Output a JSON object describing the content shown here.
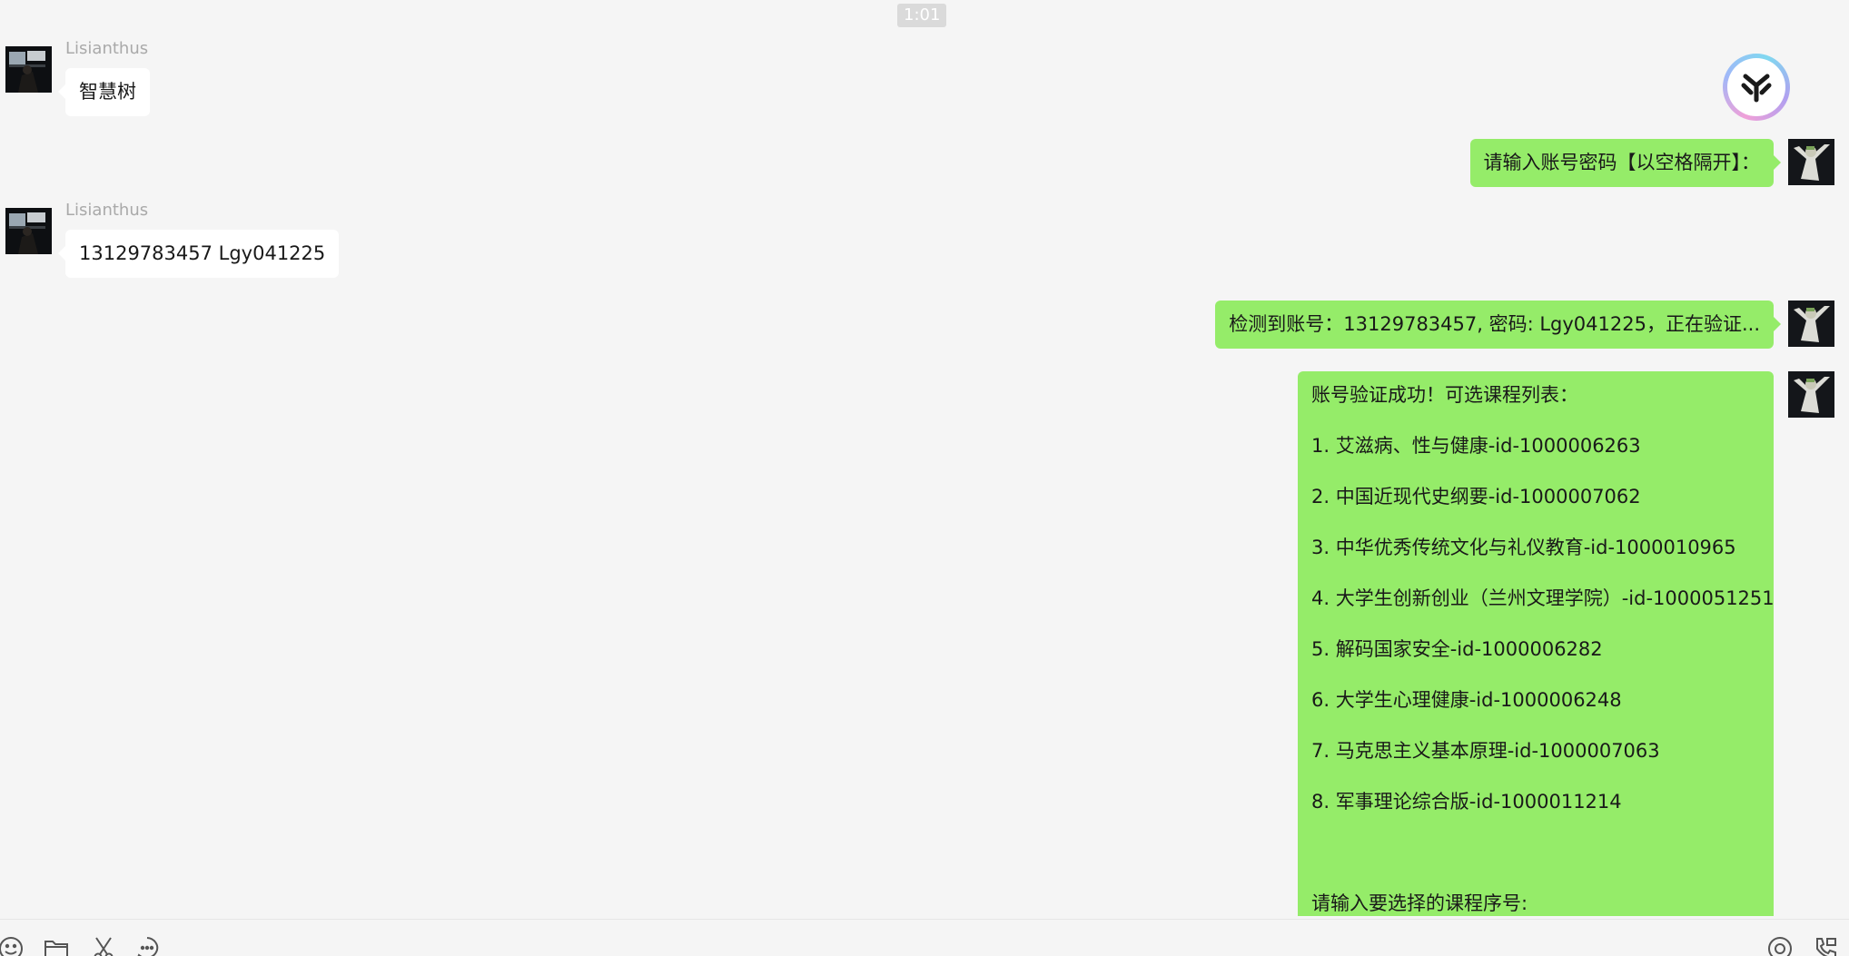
{
  "chat": {
    "time": "1:01",
    "sender_name": "Lisianthus",
    "messages": {
      "m1": "智慧树",
      "m2": "请输入账号密码【以空格隔开】：",
      "m3": "13129783457 Lgy041225",
      "m4": "检测到账号：13129783457, 密码: Lgy041225，正在验证...",
      "m5": {
        "header": "账号验证成功！可选课程列表：",
        "courses": [
          "1. 艾滋病、性与健康-id-1000006263",
          "2. 中国近现代史纲要-id-1000007062",
          "3. 中华优秀传统文化与礼仪教育-id-1000010965",
          "4. 大学生创新创业（兰州文理学院）-id-1000051251",
          "5. 解码国家安全-id-1000006282",
          "6. 大学生心理健康-id-1000006248",
          "7. 马克思主义基本原理-id-1000007063",
          "8. 军事理论综合版-id-1000011214"
        ],
        "prompt": "请输入要选择的课程序号:"
      }
    }
  },
  "colors": {
    "background": "#f5f5f5",
    "incoming_bubble": "#ffffff",
    "outgoing_bubble": "#95ec69",
    "name_text": "#a9a9a9"
  },
  "icons": {
    "toolbar_left": [
      "emoji-icon",
      "folder-icon",
      "scissors-icon",
      "chat-history-icon"
    ],
    "toolbar_right": [
      "voice-message-icon",
      "call-icon"
    ],
    "floating": "ai-assistant-icon"
  }
}
